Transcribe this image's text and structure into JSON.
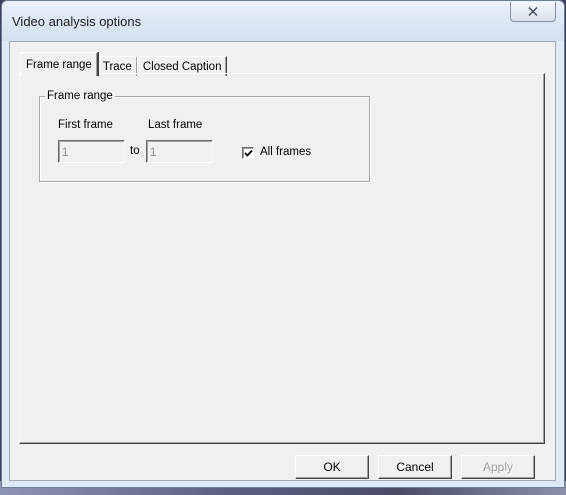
{
  "window": {
    "title": "Video analysis options",
    "close_glyph": "X"
  },
  "tabs": [
    {
      "label": "Frame range",
      "active": true
    },
    {
      "label": "Trace",
      "active": false
    },
    {
      "label": "Closed Caption",
      "active": false
    }
  ],
  "frame_range": {
    "group_title": "Frame range",
    "first_frame_label": "First frame",
    "last_frame_label": "Last frame",
    "first_frame_value": "1",
    "last_frame_value": "1",
    "to_label": "to",
    "all_frames_label": "All frames",
    "all_frames_checked": true
  },
  "buttons": {
    "ok": "OK",
    "cancel": "Cancel",
    "apply": "Apply"
  },
  "icons": {
    "close": "close-icon",
    "check": "checkmark-icon"
  }
}
